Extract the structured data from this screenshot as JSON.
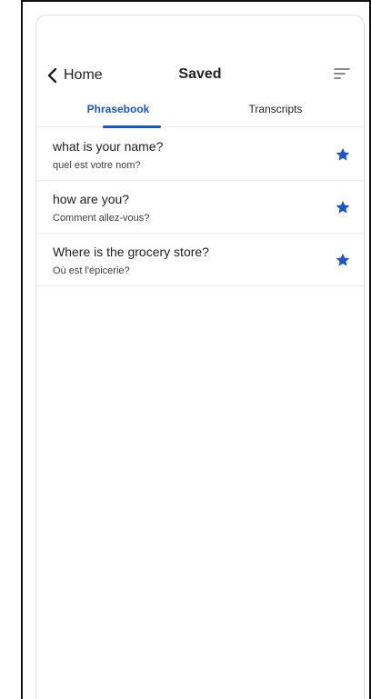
{
  "header": {
    "back_label": "Home",
    "title": "Saved"
  },
  "tabs": [
    {
      "label": "Phrasebook",
      "active": true
    },
    {
      "label": "Transcripts",
      "active": false
    }
  ],
  "phrases": [
    {
      "source": "what is your name?",
      "translation": "quel est votre nom?",
      "starred": true
    },
    {
      "source": "how are you?",
      "translation": "Comment allez-vous?",
      "starred": true
    },
    {
      "source": "Where is the grocery store?",
      "translation": "Où est l'épicerie?",
      "starred": true
    }
  ],
  "colors": {
    "accent": "#1a56c8",
    "text_primary": "#202124"
  },
  "icons": {
    "back": "chevron-left-icon",
    "sort": "sort-icon",
    "star": "star-filled-icon"
  }
}
